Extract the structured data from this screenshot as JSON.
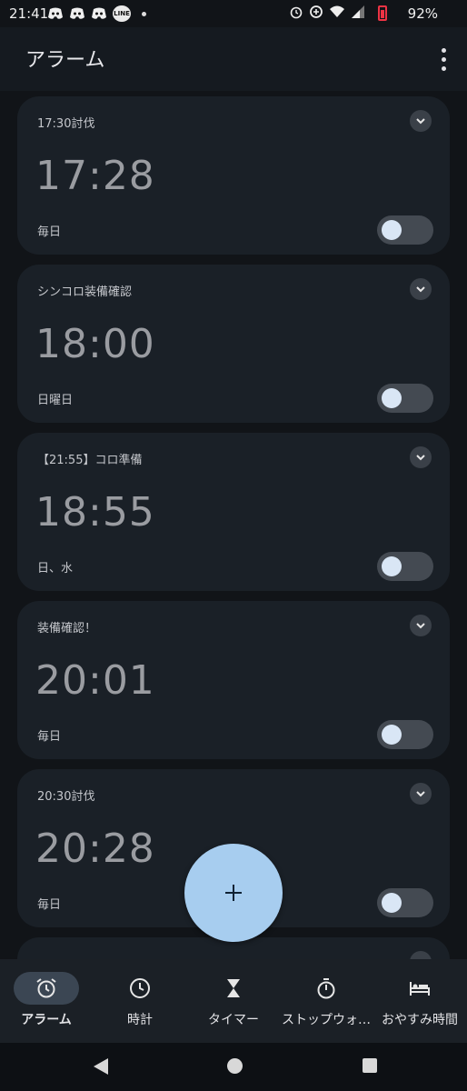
{
  "status_bar": {
    "time": "21:41",
    "battery": "92%",
    "left_icons": [
      "discord-icon",
      "discord-icon",
      "discord-icon",
      "line-icon"
    ],
    "line_text": "LINE",
    "right_icons": [
      "alarm-clock-icon",
      "data-saver-icon",
      "wifi-icon",
      "signal-icon",
      "battery-icon"
    ]
  },
  "app_bar": {
    "title": "アラーム"
  },
  "alarms": [
    {
      "label": "17:30討伐",
      "time": "17:28",
      "repeat": "毎日",
      "enabled": false
    },
    {
      "label": "シンコロ装備確認",
      "time": "18:00",
      "repeat": "日曜日",
      "enabled": false
    },
    {
      "label": "【21:55】コロ準備",
      "time": "18:55",
      "repeat": "日、水",
      "enabled": false
    },
    {
      "label": "装備確認！",
      "time": "20:01",
      "repeat": "毎日",
      "enabled": false
    },
    {
      "label": "20:30討伐",
      "time": "20:28",
      "repeat": "毎日",
      "enabled": false
    }
  ],
  "fab": {
    "icon": "plus-icon",
    "color": "#a7cdef"
  },
  "bottom_nav": {
    "items": [
      {
        "label": "アラーム",
        "icon": "alarm-icon",
        "active": true
      },
      {
        "label": "時計",
        "icon": "clock-icon",
        "active": false
      },
      {
        "label": "タイマー",
        "icon": "hourglass-icon",
        "active": false
      },
      {
        "label": "ストップウォ…",
        "icon": "stopwatch-icon",
        "active": false
      },
      {
        "label": "おやすみ時間",
        "icon": "bed-icon",
        "active": false
      }
    ]
  },
  "colors": {
    "background": "#111418",
    "card": "#1a2027",
    "accent": "#a7cdef"
  }
}
